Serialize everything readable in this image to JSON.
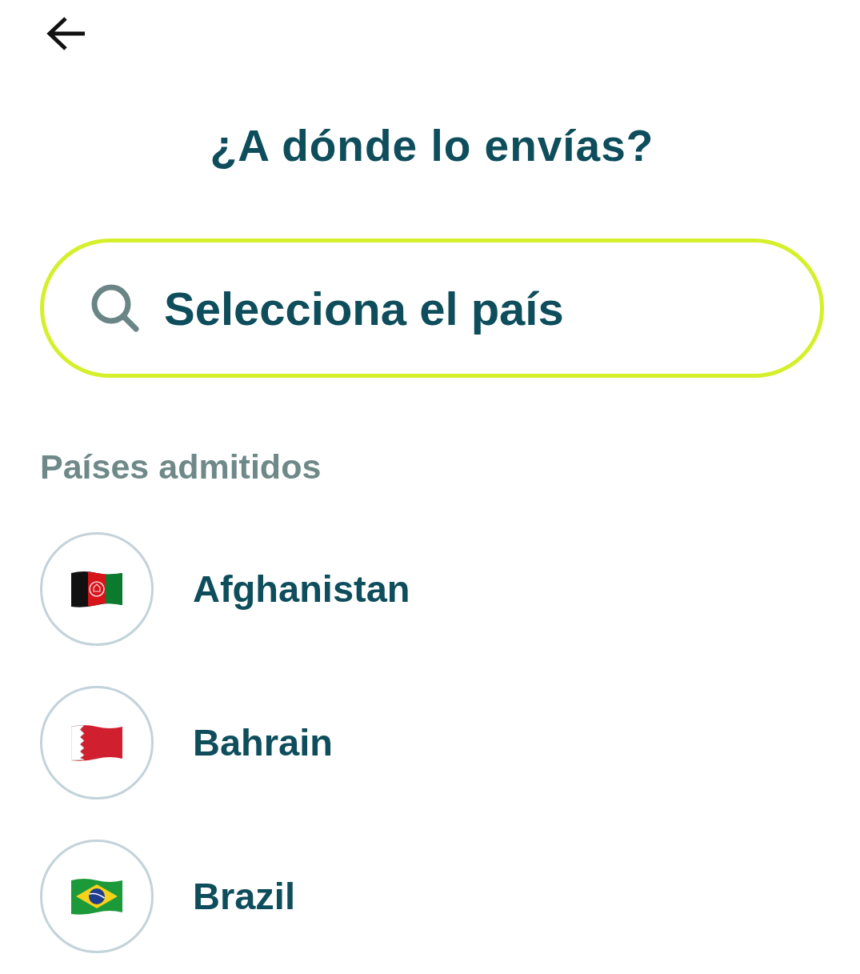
{
  "title": "¿A dónde lo envías?",
  "search": {
    "placeholder": "Selecciona el país"
  },
  "section_label": "Países admitidos",
  "countries": [
    {
      "name": "Afghanistan",
      "kind": "afghanistan"
    },
    {
      "name": "Bahrain",
      "kind": "bahrain"
    },
    {
      "name": "Brazil",
      "kind": "brazil"
    }
  ]
}
